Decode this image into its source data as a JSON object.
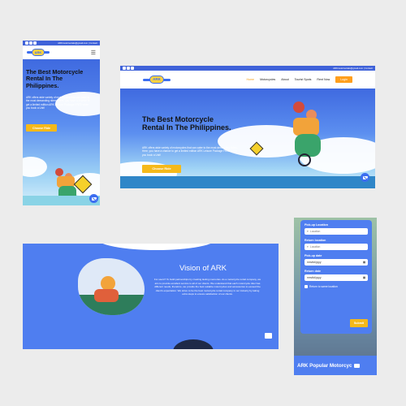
{
  "contact_email": "ARKmotorrentals@gmail.com | Contact",
  "brand": {
    "logo_text": "ARK"
  },
  "hero": {
    "headline_mobile": "The Best Motorcycle Rental In The Philippines.",
    "headline_desktop": "The Best Motorcycle Rental In The Philippines.",
    "body_mobile": "ARK offers wide variety of motorcycles that can cater to the most demanding riders. Here, you have a chance to get a limited edition ARK Leisure Package FREE when you book a Unit!",
    "body_desktop": "ARK offers wide variety of motorcycles that can cater to the most demanding riders. Here, you have a chance to get a limited edition ARK Leisure Package FREE when you book a Unit!",
    "cta": "Choose Ride"
  },
  "nav": {
    "items": [
      "Home",
      "Motorcycles",
      "About",
      "Tourist Spots",
      "Rent Now"
    ],
    "login": "Login"
  },
  "vision": {
    "title": "Vision of ARK",
    "body": "For users? To build partnerships by creating lasting memories. As a motorcycle rental company, we aim to provide excellent service to all of our clients. We understand that each motorcycle rider has different needs, therefore, we provide the best suitable motorcycles and accessories to exceed the client's expectation. We strive to be the best motorcycle rental company in our industry by taking extra steps to ensure satisfaction of our clients."
  },
  "booking": {
    "pickup_location_label": "Pick-up Location",
    "pickup_location_placeholder": "Location",
    "return_location_label": "Return location",
    "return_location_placeholder": "Location",
    "pickup_date_label": "Pick-up date",
    "pickup_date_placeholder": "mm/dd/yyyy",
    "return_date_label": "Return date",
    "return_date_placeholder": "mm/dd/yyyy",
    "same_location_label": "Return to same location",
    "submit": "Submit",
    "popular_heading": "ARK Popular Motorcyc"
  },
  "colors": {
    "blue": "#3f62d9",
    "yellow": "#f5b91a",
    "orange_nav": "#ff9f1c"
  }
}
